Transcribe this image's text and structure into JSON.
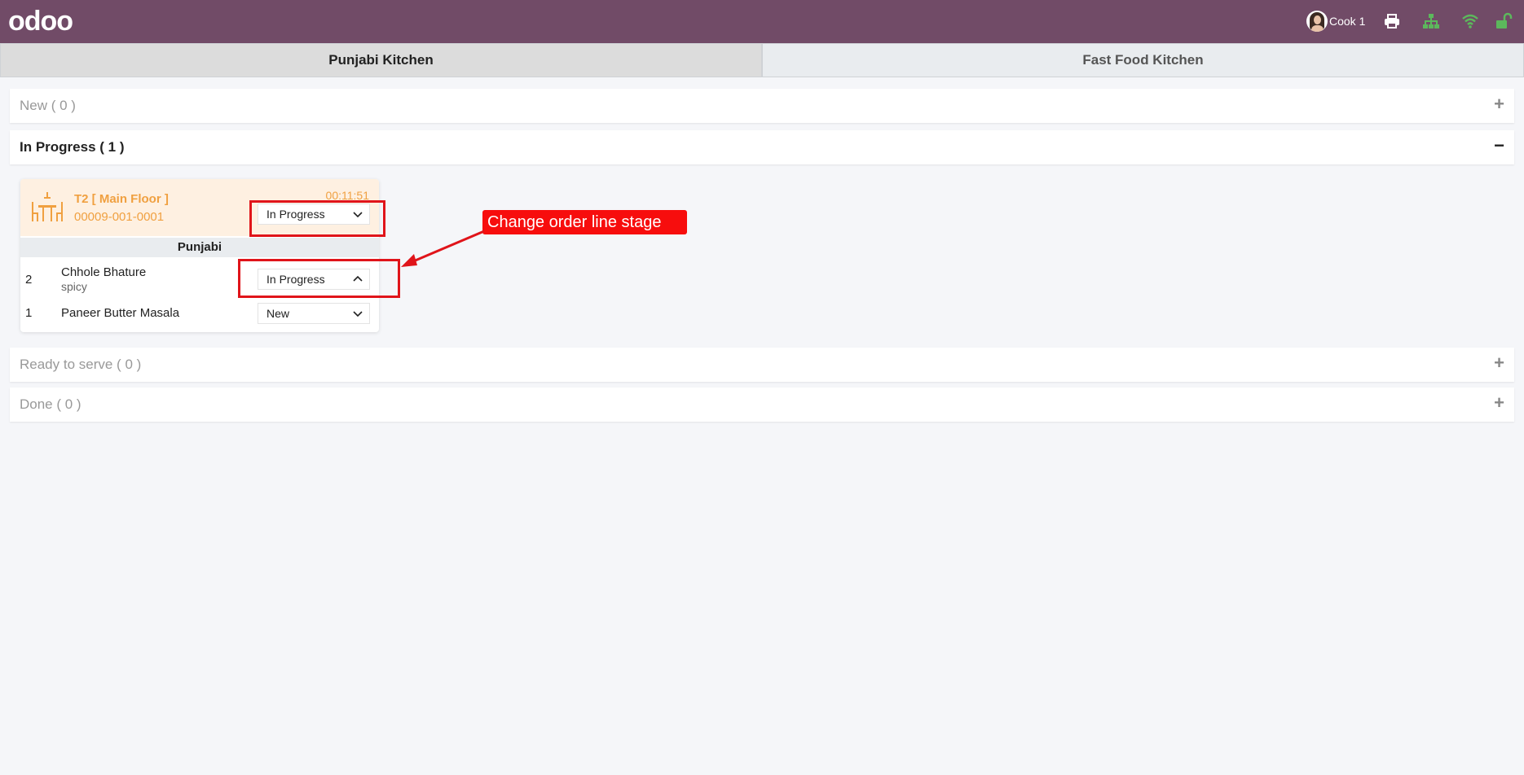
{
  "topbar": {
    "logo": "odoo",
    "user_name": "Cook 1",
    "icons": [
      "printer-icon",
      "sitemap-icon",
      "wifi-icon",
      "unlock-icon"
    ]
  },
  "tabs": [
    {
      "label": "Punjabi Kitchen",
      "active": true
    },
    {
      "label": "Fast Food Kitchen",
      "active": false
    }
  ],
  "sections": {
    "new": {
      "title": "New ( 0 )",
      "sign": "+"
    },
    "in_progress": {
      "title": "In Progress ( 1 )",
      "sign": "−"
    },
    "ready": {
      "title": "Ready to serve ( 0 )",
      "sign": "+"
    },
    "done": {
      "title": "Done ( 0 )",
      "sign": "+"
    }
  },
  "order": {
    "table": "T2 [ Main Floor ]",
    "reference": "00009-001-0001",
    "timer": "00:11:51",
    "stage": "In Progress",
    "category": "Punjabi",
    "lines": [
      {
        "qty": "2",
        "name": "Chhole Bhature",
        "note": "spicy",
        "stage": "In Progress"
      },
      {
        "qty": "1",
        "name": "Paneer Butter Masala",
        "note": "",
        "stage": "New"
      }
    ]
  },
  "annotation": {
    "callout": "Change order line stage"
  },
  "colors": {
    "brand": "#714b67",
    "accent_orange": "#f0a040",
    "status_green": "#5cb85c",
    "annotation_red": "#e0141a"
  }
}
